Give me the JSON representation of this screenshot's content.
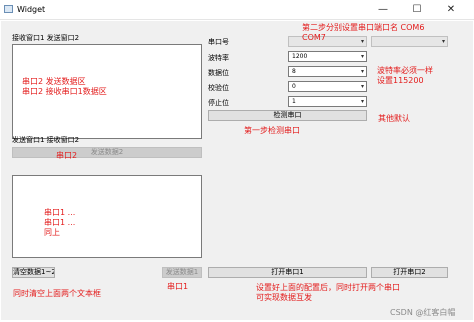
{
  "window": {
    "title": "Widget",
    "minimize_glyph": "—",
    "maximize_glyph": "☐",
    "close_glyph": "✕"
  },
  "top_area": {
    "header": "接收窗口1  发送窗口2",
    "annotation_lines": [
      "串口2 发送数据区",
      "串口2 接收串口1数据区"
    ]
  },
  "bottom_area": {
    "header": "发送窗口1  接收窗口2",
    "send2_button": "发送数据2",
    "label_port2": "串口2",
    "annotation_lines": [
      "串口1 ...",
      "串口1 ...",
      "同上"
    ]
  },
  "settings": {
    "rows": [
      {
        "label": "串口号",
        "value": ""
      },
      {
        "label": "波特率",
        "value": "1200"
      },
      {
        "label": "数据位",
        "value": "8"
      },
      {
        "label": "校验位",
        "value": "0"
      },
      {
        "label": "停止位",
        "value": "1"
      }
    ],
    "detect_button": "检测串口"
  },
  "annotations": {
    "step2": [
      "第二步分别设置串口端口名 COM6",
      "COM7"
    ],
    "baud": [
      "波特率必须一样",
      "设置115200"
    ],
    "step1": "第一步检测串口",
    "others": "其他默认",
    "clear_note": "同时清空上面两个文本框",
    "port1_note": "串口1",
    "config_note": [
      "设置好上面的配置后，同时打开两个串口",
      "可实现数据互发"
    ]
  },
  "bottom_bar": {
    "clear_button": "清空数据1~2",
    "send1_button": "发送数据1",
    "open1_button": "打开串口1",
    "open2_button": "打开串口2"
  },
  "watermark": "CSDN @红客白帽",
  "colors": {
    "annotation": "#e31b1b"
  }
}
